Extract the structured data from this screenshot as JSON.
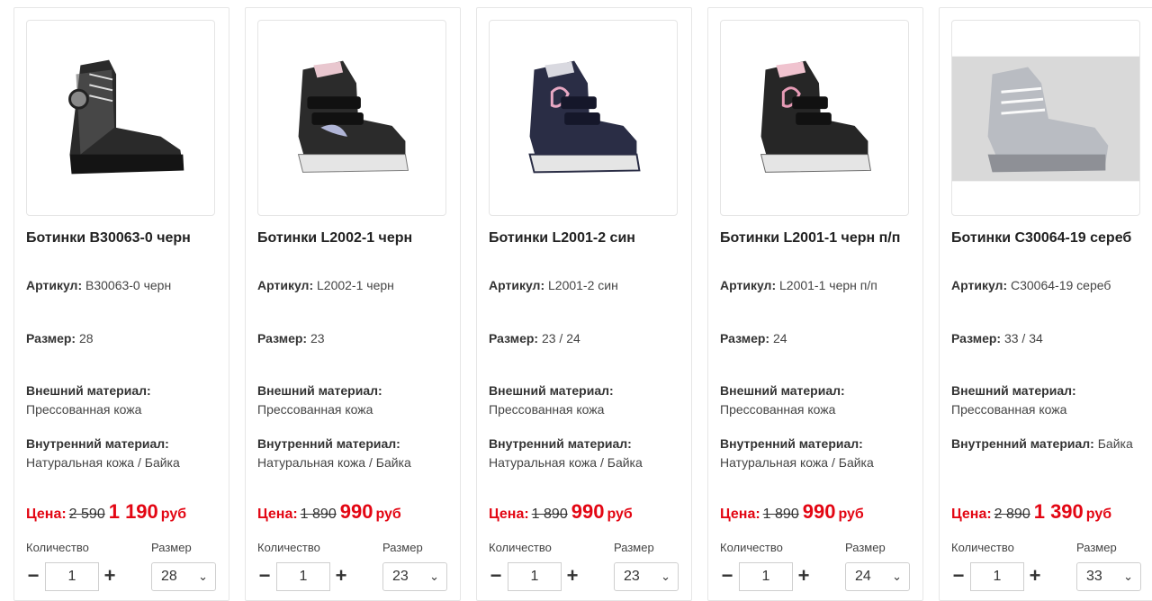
{
  "labels": {
    "article": "Артикул:",
    "size": "Размер:",
    "outer": "Внешний материал:",
    "inner": "Внутренний материал:",
    "price": "Цена:",
    "qty": "Количество",
    "size_select": "Размер",
    "minus": "−",
    "plus": "+",
    "chevron": "⌄"
  },
  "colors": {
    "price": "#e30613"
  },
  "products": [
    {
      "title": "Ботинки В30063-0 черн",
      "article": "В30063-0 черн",
      "size": "28",
      "outer_material": "Прессованная кожа",
      "inner_material": "Натуральная кожа / Байка",
      "old_price": "2 590",
      "new_price": "1 190",
      "currency": "руб",
      "quantity": "1",
      "selected_size": "28",
      "image_icon": "black-studded-boot"
    },
    {
      "title": "Ботинки L2002-1 черн",
      "article": "L2002-1 черн",
      "size": "23",
      "outer_material": "Прессованная кожа",
      "inner_material": "Натуральная кожа / Байка",
      "old_price": "1 890",
      "new_price": "990",
      "currency": "руб",
      "quantity": "1",
      "selected_size": "23",
      "image_icon": "black-velcro-boot"
    },
    {
      "title": "Ботинки L2001-2 син",
      "article": "L2001-2 син",
      "size": "23 / 24",
      "outer_material": "Прессованная кожа",
      "inner_material": "Натуральная кожа / Байка",
      "old_price": "1 890",
      "new_price": "990",
      "currency": "руб",
      "quantity": "1",
      "selected_size": "23",
      "image_icon": "navy-velcro-boot"
    },
    {
      "title": "Ботинки L2001-1 черн п/п",
      "article": "L2001-1 черн п/п",
      "size": "24",
      "outer_material": "Прессованная кожа",
      "inner_material": "Натуральная кожа / Байка",
      "old_price": "1 890",
      "new_price": "990",
      "currency": "руб",
      "quantity": "1",
      "selected_size": "24",
      "image_icon": "black-velcro-boot-pink"
    },
    {
      "title": "Ботинки С30064-19 сереб",
      "article": "С30064-19 сереб",
      "size": "33 / 34",
      "outer_material": "Прессованная кожа",
      "inner_material": "Байка",
      "old_price": "2 890",
      "new_price": "1 390",
      "currency": "руб",
      "quantity": "1",
      "selected_size": "33",
      "image_icon": "silver-sneaker-boot"
    }
  ]
}
